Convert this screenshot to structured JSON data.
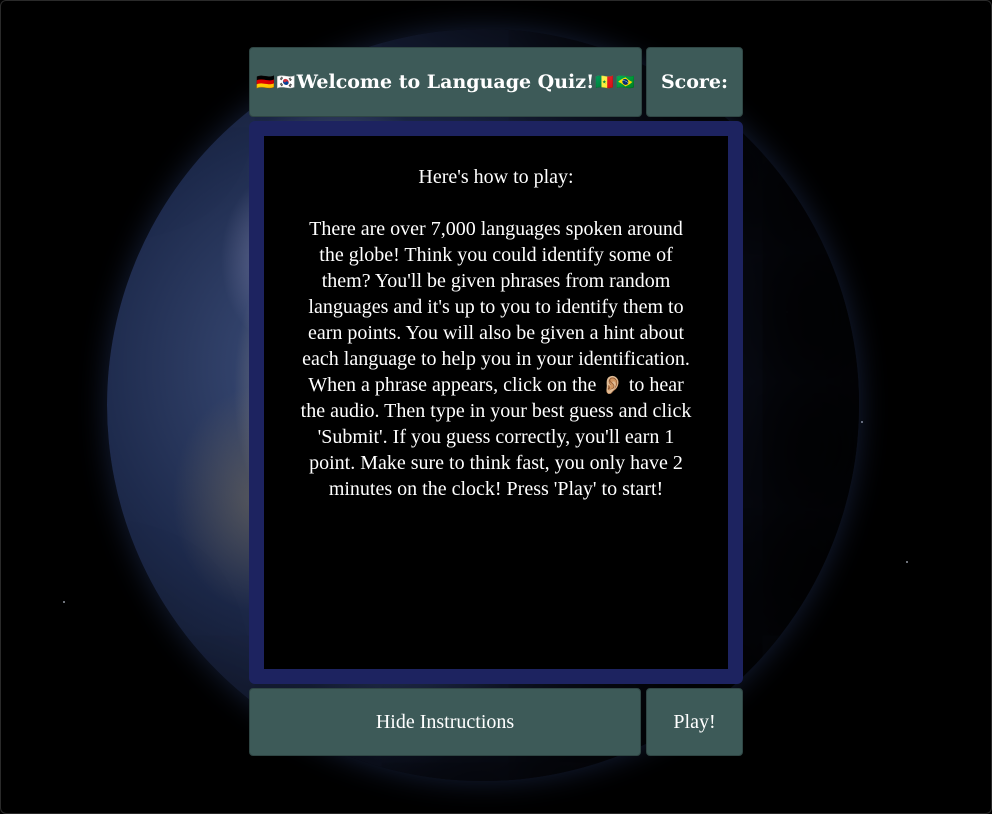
{
  "header": {
    "flags_left": [
      "🇩🇪",
      "🇰🇷"
    ],
    "title": "Welcome to Language Quiz!",
    "flags_right": [
      "🇸🇳",
      "🇧🇷"
    ],
    "score_label": "Score:"
  },
  "instructions": {
    "heading": "Here's how to play:",
    "body_part1": "There are over 7,000 languages spoken around the globe! Think you could identify some of them? You'll be given phrases from random languages and it's up to you to identify them to earn points. You will also be given a hint about each language to help you in your identification. When a phrase appears, click on the",
    "ear_icon": "👂🏼",
    "body_part2": "to hear the audio. Then type in your best guess and click 'Submit'. If you guess correctly, you'll earn 1 point. Make sure to think fast, you only have 2 minutes on the clock! Press 'Play' to start!"
  },
  "controls": {
    "hide_label": "Hide Instructions",
    "play_label": "Play!"
  },
  "colors": {
    "tile_bg": "#3d5a58",
    "panel_border": "#1d2360",
    "panel_bg": "#000000"
  }
}
